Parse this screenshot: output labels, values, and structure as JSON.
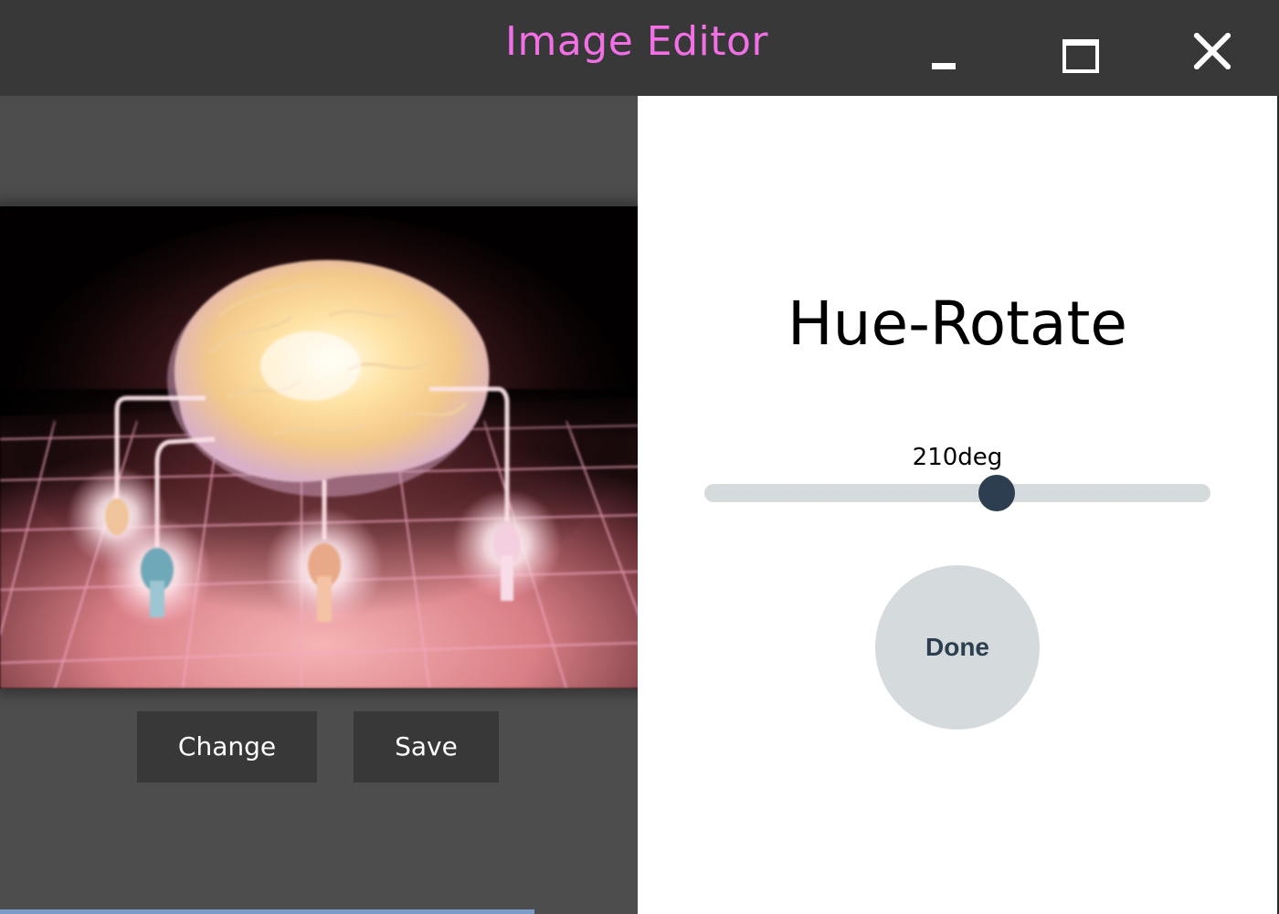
{
  "window": {
    "title": "Image Editor",
    "title_color": "#f26fe6",
    "titlebar_color": "#383838"
  },
  "controls": {
    "minimize_icon": "minimize-icon",
    "maximize_icon": "maximize-icon",
    "close_icon": "close-icon"
  },
  "left_pane": {
    "image_description_icon": "glowing-brain-image",
    "buttons": {
      "change_label": "Change",
      "save_label": "Save"
    }
  },
  "right_pane": {
    "filter_name": "Hue-Rotate",
    "value_label": "210deg",
    "slider": {
      "value_fraction": 0.578
    },
    "done_label": "Done",
    "accent_color": "#2c3e50",
    "track_color": "#d5dadd"
  }
}
